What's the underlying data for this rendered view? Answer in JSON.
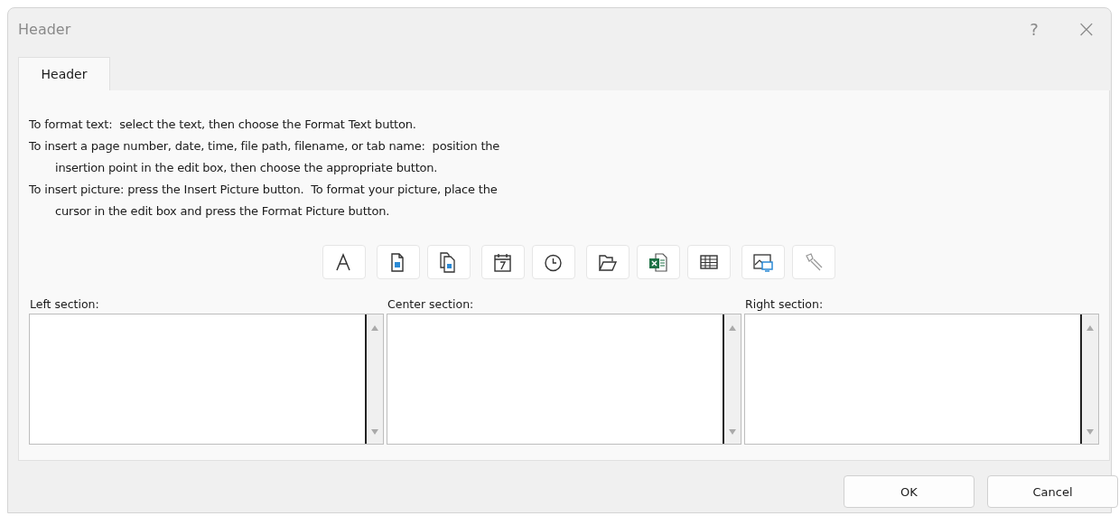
{
  "window": {
    "title": "Header",
    "help": "?",
    "close": "×"
  },
  "tabs": [
    {
      "label": "Header",
      "selected": true
    }
  ],
  "instructions": [
    {
      "lines": [
        "To format text:  select the text, then choose the Format Text button."
      ]
    },
    {
      "lines": [
        "To insert a page number, date, time, file path, filename, or tab name:  position the",
        "insertion point in the edit box, then choose the appropriate button."
      ]
    },
    {
      "lines": [
        "To insert picture: press the Insert Picture button.  To format your picture, place the",
        "cursor in the edit box and press the Format Picture button."
      ]
    }
  ],
  "toolbar": [
    [
      {
        "kind": "font"
      }
    ],
    [
      {
        "kind": "page"
      },
      {
        "kind": "pages"
      }
    ],
    [
      {
        "kind": "date"
      },
      {
        "kind": "time"
      }
    ],
    [
      {
        "kind": "path"
      },
      {
        "kind": "file"
      },
      {
        "kind": "sheet"
      }
    ],
    [
      {
        "kind": "picture"
      },
      {
        "kind": "format"
      }
    ]
  ],
  "sections": [
    {
      "label": "Left section:"
    },
    {
      "label": "Center section:"
    },
    {
      "label": "Right section:"
    }
  ],
  "buttons": [
    "OK",
    "Cancel"
  ]
}
